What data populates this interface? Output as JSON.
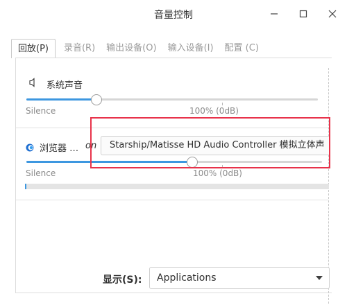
{
  "window": {
    "title": "音量控制"
  },
  "tabs": [
    {
      "label": "回放(P)",
      "active": true
    },
    {
      "label": "录音(R)",
      "active": false
    },
    {
      "label": "输出设备(O)",
      "active": false
    },
    {
      "label": "输入设备(I)",
      "active": false
    },
    {
      "label": "配置 (C)",
      "active": false
    }
  ],
  "system_sound": {
    "label": "系统声音",
    "icon": "speaker-icon",
    "volume_fraction": 0.24,
    "min_label": "Silence",
    "ref_label": "100% (0dB)"
  },
  "browser_stream": {
    "label": "浏览器 …",
    "on_text": "on",
    "icon": "browser-icon",
    "device": "Starship/Matisse HD Audio Controller 模拟立体声",
    "volume_fraction": 0.56,
    "min_label": "Silence",
    "ref_label": "100% (0dB)"
  },
  "footer": {
    "show_label": "显示(S):",
    "show_value": "Applications"
  },
  "colors": {
    "accent": "#3d97e0",
    "highlight": "#e8324a"
  }
}
